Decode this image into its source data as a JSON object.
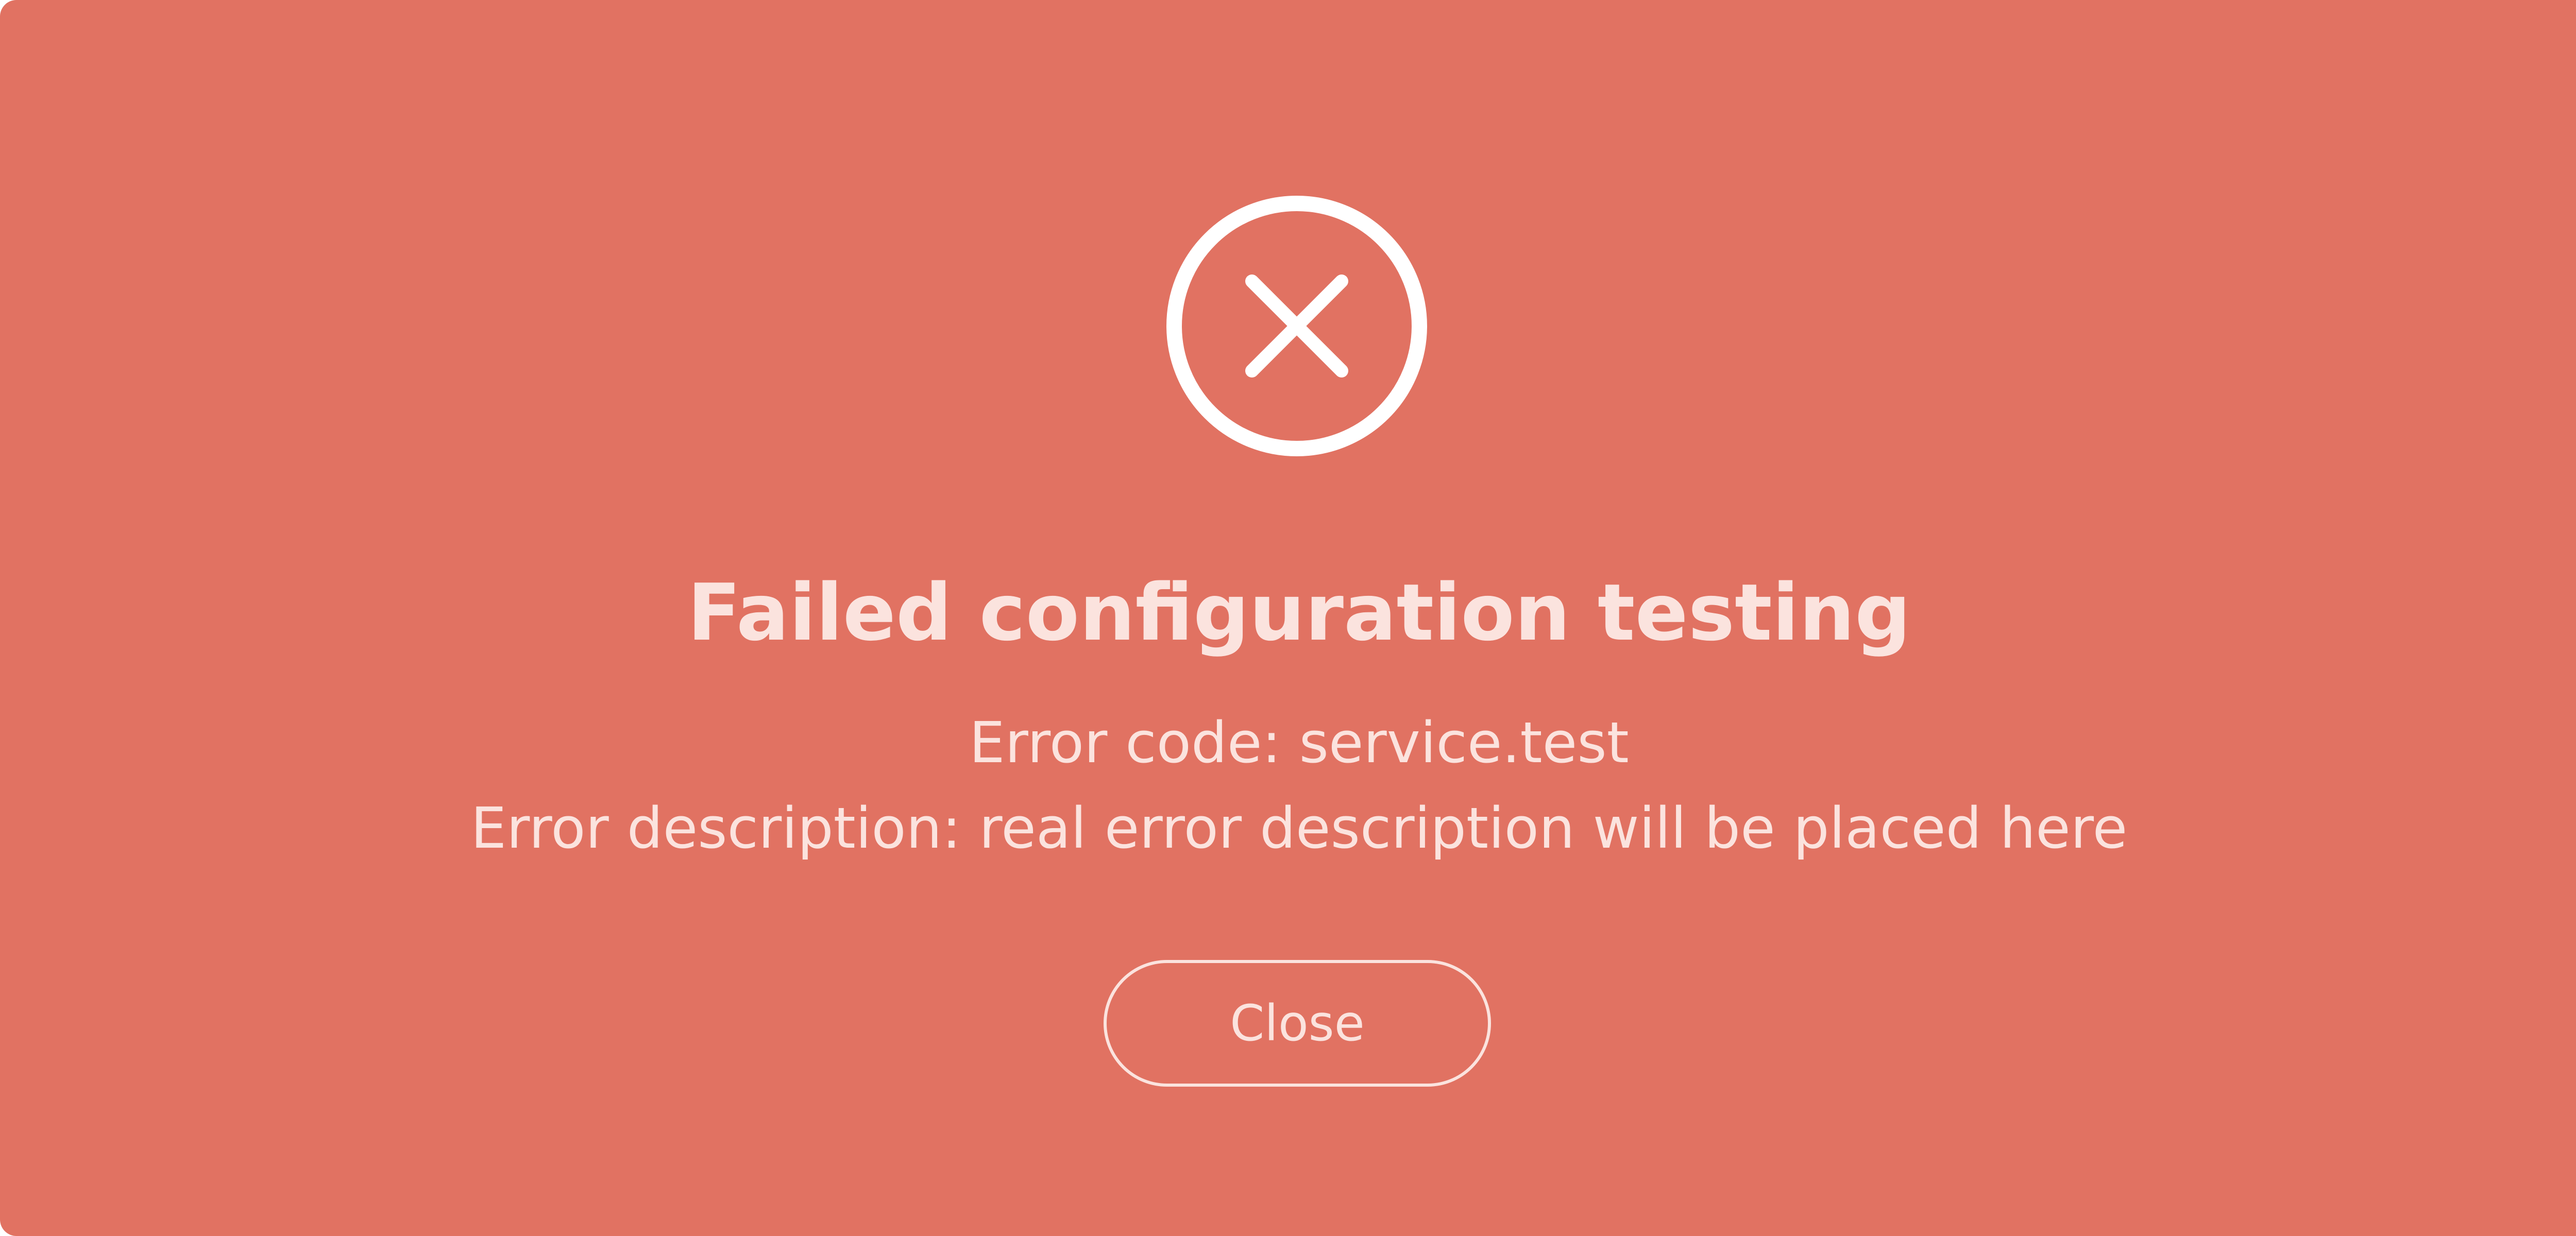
{
  "dialog": {
    "icon": "close-circle-icon",
    "title": "Failed configuration testing",
    "error_code_line": "Error code: service.test",
    "error_description_line": "Error description: real error description will be placed here",
    "close_label": "Close"
  },
  "colors": {
    "background": "#e17262",
    "foreground": "#fbe3de",
    "icon": "#ffffff"
  }
}
